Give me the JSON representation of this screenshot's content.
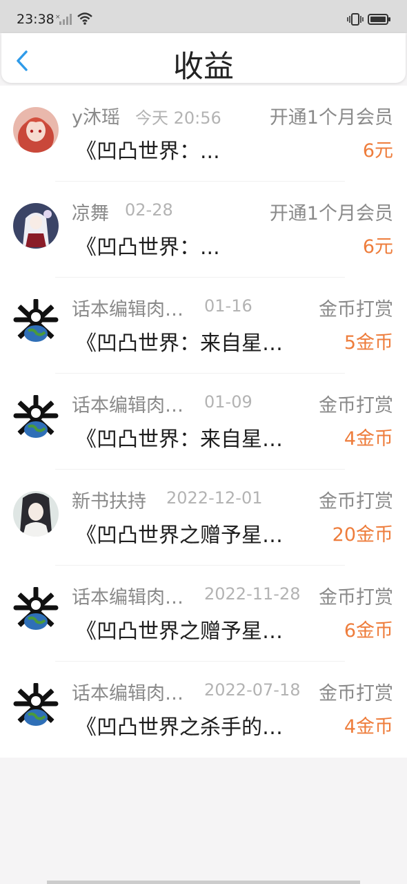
{
  "status_bar": {
    "time": "23:38"
  },
  "header": {
    "title": "收益"
  },
  "earnings": [
    {
      "name": "y沐瑶",
      "date": "今天 20:56",
      "type": "开通1个月会员",
      "book": "《凹凸世界：...",
      "amount": "6元",
      "avatar": "anime-girl-red"
    },
    {
      "name": "凉舞",
      "date": "02-28",
      "type": "开通1个月会员",
      "book": "《凹凸世界：...",
      "amount": "6元",
      "avatar": "anime-girl-white"
    },
    {
      "name": "话本编辑肉…",
      "date": "01-16",
      "type": "金币打赏",
      "book": "《凹凸世界：来自星…",
      "amount": "5金币",
      "avatar": "skull-globe"
    },
    {
      "name": "话本编辑肉…",
      "date": "01-09",
      "type": "金币打赏",
      "book": "《凹凸世界：来自星…",
      "amount": "4金币",
      "avatar": "skull-globe"
    },
    {
      "name": "新书扶持",
      "date": "2022-12-01",
      "type": "金币打赏",
      "book": "《凹凸世界之赠予星…",
      "amount": "20金币",
      "avatar": "anime-boy"
    },
    {
      "name": "话本编辑肉…",
      "date": "2022-11-28",
      "type": "金币打赏",
      "book": "《凹凸世界之赠予星…",
      "amount": "6金币",
      "avatar": "skull-globe"
    },
    {
      "name": "话本编辑肉…",
      "date": "2022-07-18",
      "type": "金币打赏",
      "book": "《凹凸世界之杀手的…",
      "amount": "4金币",
      "avatar": "skull-globe"
    }
  ],
  "colors": {
    "accent": "#2f9be9",
    "amount": "#ee7d3c",
    "muted_text": "#8a8a8a"
  }
}
